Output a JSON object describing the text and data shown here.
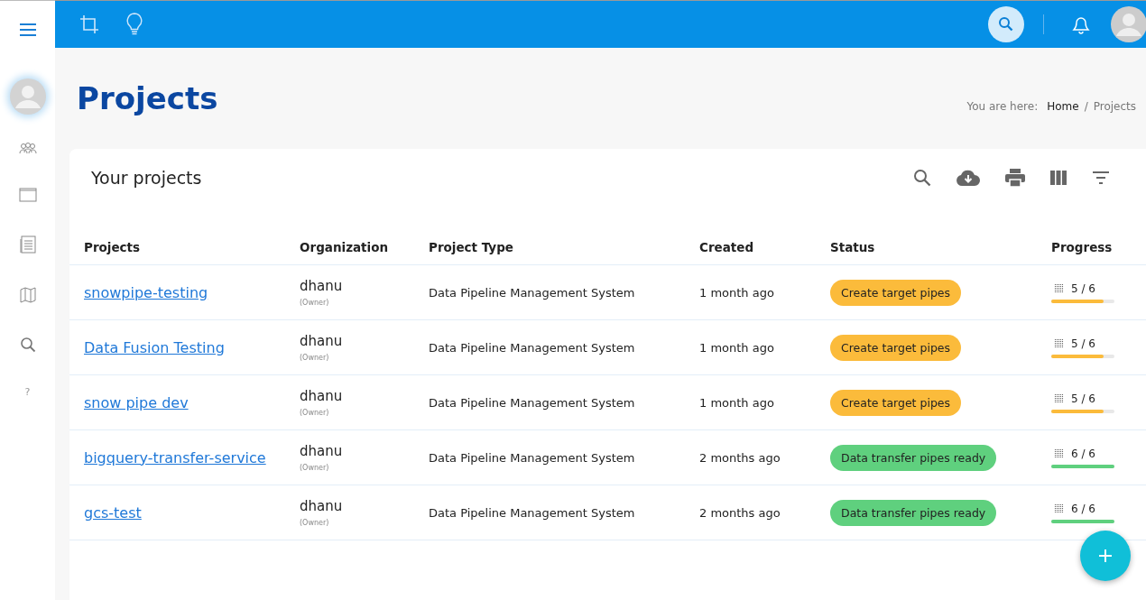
{
  "sidebar": {
    "help_text": "?"
  },
  "page": {
    "title": "Projects",
    "breadcrumb": {
      "prefix": "You are here:",
      "separator": "/",
      "items": [
        {
          "label": "Home",
          "current": false
        },
        {
          "label": "Projects",
          "current": true
        }
      ]
    }
  },
  "card": {
    "title": "Your projects"
  },
  "table": {
    "columns": [
      "Projects",
      "Organization",
      "Project Type",
      "Created",
      "Status",
      "Progress"
    ],
    "rows": [
      {
        "name": "snowpipe-testing",
        "org": "dhanu",
        "role": "(Owner)",
        "type": "Data Pipeline Management System",
        "created": "1 month ago",
        "status": "Create target pipes",
        "color": "#fbbb3b",
        "progress": "5 / 6",
        "level": 0.833
      },
      {
        "name": "Data Fusion Testing",
        "org": "dhanu",
        "role": "(Owner)",
        "type": "Data Pipeline Management System",
        "created": "1 month ago",
        "status": "Create target pipes",
        "color": "#fbbb3b",
        "progress": "5 / 6",
        "level": 0.833
      },
      {
        "name": "snow pipe dev",
        "org": "dhanu",
        "role": "(Owner)",
        "type": "Data Pipeline Management System",
        "created": "1 month ago",
        "status": "Create target pipes",
        "color": "#fbbb3b",
        "progress": "5 / 6",
        "level": 0.833
      },
      {
        "name": "bigquery-transfer-service",
        "org": "dhanu",
        "role": "(Owner)",
        "type": "Data Pipeline Management System",
        "created": "2 months ago",
        "status": "Data transfer pipes ready",
        "color": "#5fd07e",
        "progress": "6 / 6",
        "level": 1
      },
      {
        "name": "gcs-test",
        "org": "dhanu",
        "role": "(Owner)",
        "type": "Data Pipeline Management System",
        "created": "2 months ago",
        "status": "Data transfer pipes ready",
        "color": "#5fd07e",
        "progress": "6 / 6",
        "level": 1
      }
    ]
  }
}
